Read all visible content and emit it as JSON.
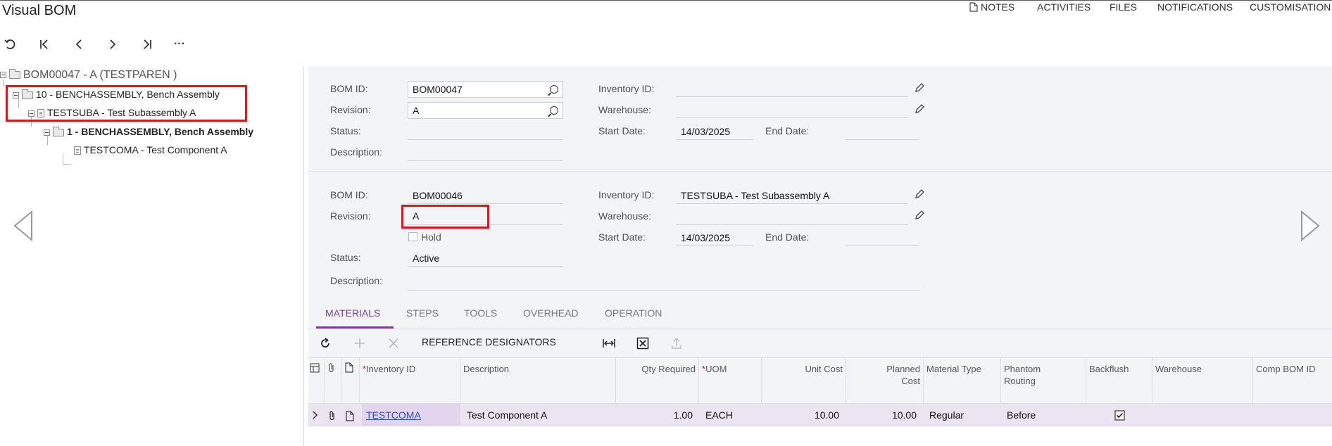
{
  "window": {
    "title": "Visual BOM"
  },
  "top_links": [
    "NOTES",
    "ACTIVITIES",
    "FILES",
    "NOTIFICATIONS",
    "CUSTOMISATION"
  ],
  "toolbar": {
    "icons": [
      "undo-icon",
      "first-record-icon",
      "previous-record-icon",
      "next-record-icon",
      "last-record-icon",
      "more-icon"
    ],
    "more_label": "···"
  },
  "tree": {
    "root": "BOM00047 - A (TESTPAREN )",
    "nodes": [
      {
        "label": "10 - BENCHASSEMBLY, Bench Assembly",
        "icon": "folder-icon",
        "bold": false
      },
      {
        "label": "TESTSUBA - Test Subassembly A",
        "icon": "document-icon",
        "bold": false
      },
      {
        "label": "1 - BENCHASSEMBLY, Bench Assembly",
        "icon": "folder-icon",
        "bold": true
      },
      {
        "label": "TESTCOMA - Test Component A",
        "icon": "document-icon",
        "bold": false
      }
    ]
  },
  "parent_form": {
    "bom_id_label": "BOM ID:",
    "bom_id": "BOM00047",
    "revision_label": "Revision:",
    "revision": "A",
    "status_label": "Status:",
    "status": "",
    "description_label": "Description:",
    "description": "",
    "inventory_id_label": "Inventory ID:",
    "inventory_id": "",
    "warehouse_label": "Warehouse:",
    "warehouse": "",
    "start_date_label": "Start Date:",
    "start_date": "14/03/2025",
    "end_date_label": "End Date:",
    "end_date": ""
  },
  "child_form": {
    "bom_id_label": "BOM ID:",
    "bom_id": "BOM00046",
    "revision_label": "Revision:",
    "revision": "A",
    "hold_label": "Hold",
    "hold_checked": false,
    "status_label": "Status:",
    "status": "Active",
    "description_label": "Description:",
    "description": "",
    "inventory_id_label": "Inventory ID:",
    "inventory_id": "TESTSUBA - Test Subassembly A",
    "warehouse_label": "Warehouse:",
    "warehouse": "",
    "start_date_label": "Start Date:",
    "start_date": "14/03/2025",
    "end_date_label": "End Date:",
    "end_date": ""
  },
  "tabs": [
    {
      "label": "MATERIALS",
      "active": true
    },
    {
      "label": "STEPS",
      "active": false
    },
    {
      "label": "TOOLS",
      "active": false
    },
    {
      "label": "OVERHEAD",
      "active": false
    },
    {
      "label": "OPERATION",
      "active": false
    }
  ],
  "grid_toolbar": {
    "ref_designators": "REFERENCE DESIGNATORS"
  },
  "table": {
    "columns": {
      "inventory_id": "Inventory ID",
      "description": "Description",
      "qty_required": "Qty Required",
      "uom": "UOM",
      "unit_cost": "Unit Cost",
      "planned_cost_1": "Planned",
      "planned_cost_2": "Cost",
      "material_type": "Material Type",
      "phantom_1": "Phantom",
      "phantom_2": "Routing",
      "backflush": "Backflush",
      "warehouse": "Warehouse",
      "comp_bom_id": "Comp BOM ID"
    },
    "required_marker": "*",
    "rows": [
      {
        "inventory_id": "TESTCOMA",
        "description": "Test Component A",
        "qty_required": "1.00",
        "uom": "EACH",
        "unit_cost": "10.00",
        "planned_cost": "10.00",
        "material_type": "Regular",
        "phantom_routing": "Before",
        "backflush": true,
        "warehouse": "",
        "comp_bom_id": ""
      }
    ]
  },
  "colors": {
    "accent": "#7b3f98",
    "highlight": "#e0161e",
    "link": "#2a4fcf"
  }
}
